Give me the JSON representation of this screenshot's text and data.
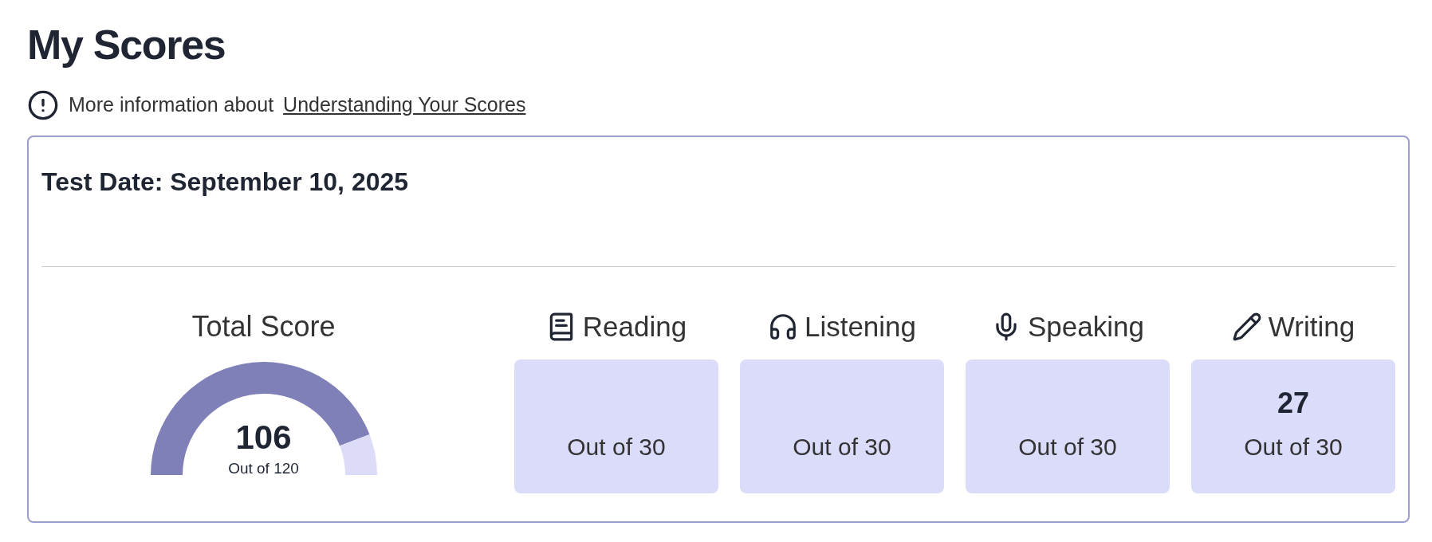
{
  "title": "My Scores",
  "info": {
    "text": "More information about",
    "link": "Understanding Your Scores"
  },
  "test": {
    "date": "Test Date: September 10, 2025",
    "total": {
      "label": "Total Score",
      "value": "106",
      "out_of": "Out of 120"
    },
    "sections": [
      {
        "kind": "reading",
        "label": "Reading",
        "out_of": "Out of 30"
      },
      {
        "kind": "listening",
        "label": "Listening",
        "out_of": "Out of 30"
      },
      {
        "kind": "speaking",
        "label": "Speaking",
        "out_of": "Out of 30"
      },
      {
        "kind": "writing",
        "label": "Writing",
        "score": "27",
        "out_of": "Out of 30"
      }
    ]
  }
}
